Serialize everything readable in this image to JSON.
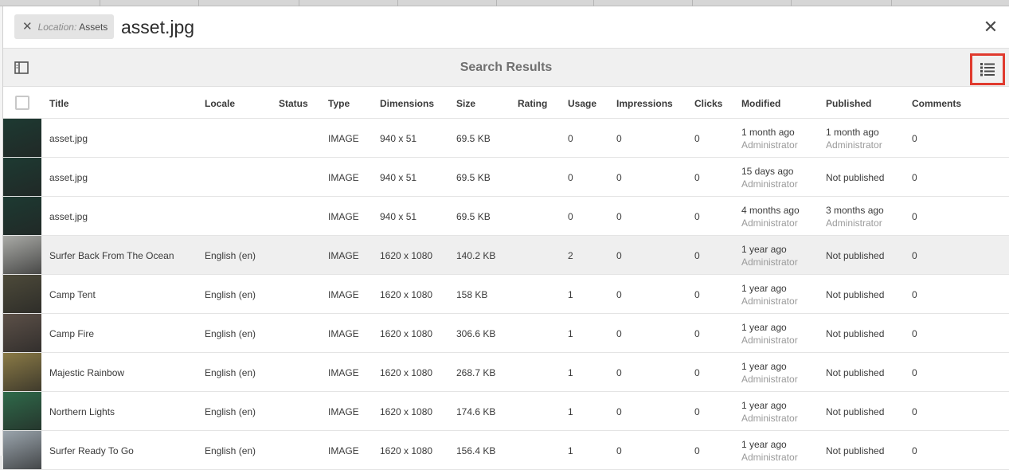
{
  "header": {
    "close_tag_glyph": "✕",
    "filter_key": "Location:",
    "filter_value": "Assets",
    "title": "asset.jpg",
    "close_glyph": "✕"
  },
  "actionbar": {
    "title": "Search Results",
    "rail_icon": "rail-toggle-icon",
    "view_icon": "list-view-icon",
    "view_highlight_color": "#e03a2e"
  },
  "columns": [
    "Title",
    "Locale",
    "Status",
    "Type",
    "Dimensions",
    "Size",
    "Rating",
    "Usage",
    "Impressions",
    "Clicks",
    "Modified",
    "Published",
    "Comments"
  ],
  "rows": [
    {
      "title": "asset.jpg",
      "locale": "",
      "status": "",
      "type": "IMAGE",
      "dimensions": "940 x 51",
      "size": "69.5 KB",
      "rating": "",
      "usage": "0",
      "impressions": "0",
      "clicks": "0",
      "modified": "1 month ago",
      "modified_by": "Administrator",
      "published": "1 month ago",
      "published_by": "Administrator",
      "comments": "0",
      "thumb_color": "#1d3a32",
      "selected": false
    },
    {
      "title": "asset.jpg",
      "locale": "",
      "status": "",
      "type": "IMAGE",
      "dimensions": "940 x 51",
      "size": "69.5 KB",
      "rating": "",
      "usage": "0",
      "impressions": "0",
      "clicks": "0",
      "modified": "15 days ago",
      "modified_by": "Administrator",
      "published": "Not published",
      "published_by": "",
      "comments": "0",
      "thumb_color": "#1d3a32",
      "selected": false
    },
    {
      "title": "asset.jpg",
      "locale": "",
      "status": "",
      "type": "IMAGE",
      "dimensions": "940 x 51",
      "size": "69.5 KB",
      "rating": "",
      "usage": "0",
      "impressions": "0",
      "clicks": "0",
      "modified": "4 months ago",
      "modified_by": "Administrator",
      "published": "3 months ago",
      "published_by": "Administrator",
      "comments": "0",
      "thumb_color": "#1d3a32",
      "selected": false
    },
    {
      "title": "Surfer Back From The Ocean",
      "locale": "English (en)",
      "status": "",
      "type": "IMAGE",
      "dimensions": "1620 x 1080",
      "size": "140.2 KB",
      "rating": "",
      "usage": "2",
      "impressions": "0",
      "clicks": "0",
      "modified": "1 year ago",
      "modified_by": "Administrator",
      "published": "Not published",
      "published_by": "",
      "comments": "0",
      "thumb_color": "#a9aaa6",
      "selected": true
    },
    {
      "title": "Camp Tent",
      "locale": "English (en)",
      "status": "",
      "type": "IMAGE",
      "dimensions": "1620 x 1080",
      "size": "158 KB",
      "rating": "",
      "usage": "1",
      "impressions": "0",
      "clicks": "0",
      "modified": "1 year ago",
      "modified_by": "Administrator",
      "published": "Not published",
      "published_by": "",
      "comments": "0",
      "thumb_color": "#4d4a3a",
      "selected": false
    },
    {
      "title": "Camp Fire",
      "locale": "English (en)",
      "status": "",
      "type": "IMAGE",
      "dimensions": "1620 x 1080",
      "size": "306.6 KB",
      "rating": "",
      "usage": "1",
      "impressions": "0",
      "clicks": "0",
      "modified": "1 year ago",
      "modified_by": "Administrator",
      "published": "Not published",
      "published_by": "",
      "comments": "0",
      "thumb_color": "#5c5048",
      "selected": false
    },
    {
      "title": "Majestic Rainbow",
      "locale": "English (en)",
      "status": "",
      "type": "IMAGE",
      "dimensions": "1620 x 1080",
      "size": "268.7 KB",
      "rating": "",
      "usage": "1",
      "impressions": "0",
      "clicks": "0",
      "modified": "1 year ago",
      "modified_by": "Administrator",
      "published": "Not published",
      "published_by": "",
      "comments": "0",
      "thumb_color": "#8a7a46",
      "selected": false
    },
    {
      "title": "Northern Lights",
      "locale": "English (en)",
      "status": "",
      "type": "IMAGE",
      "dimensions": "1620 x 1080",
      "size": "174.6 KB",
      "rating": "",
      "usage": "1",
      "impressions": "0",
      "clicks": "0",
      "modified": "1 year ago",
      "modified_by": "Administrator",
      "published": "Not published",
      "published_by": "",
      "comments": "0",
      "thumb_color": "#2f6a4a",
      "selected": false
    },
    {
      "title": "Surfer Ready To Go",
      "locale": "English (en)",
      "status": "",
      "type": "IMAGE",
      "dimensions": "1620 x 1080",
      "size": "156.4 KB",
      "rating": "",
      "usage": "1",
      "impressions": "0",
      "clicks": "0",
      "modified": "1 year ago",
      "modified_by": "Administrator",
      "published": "Not published",
      "published_by": "",
      "comments": "0",
      "thumb_color": "#9aa4ac",
      "selected": false
    }
  ]
}
